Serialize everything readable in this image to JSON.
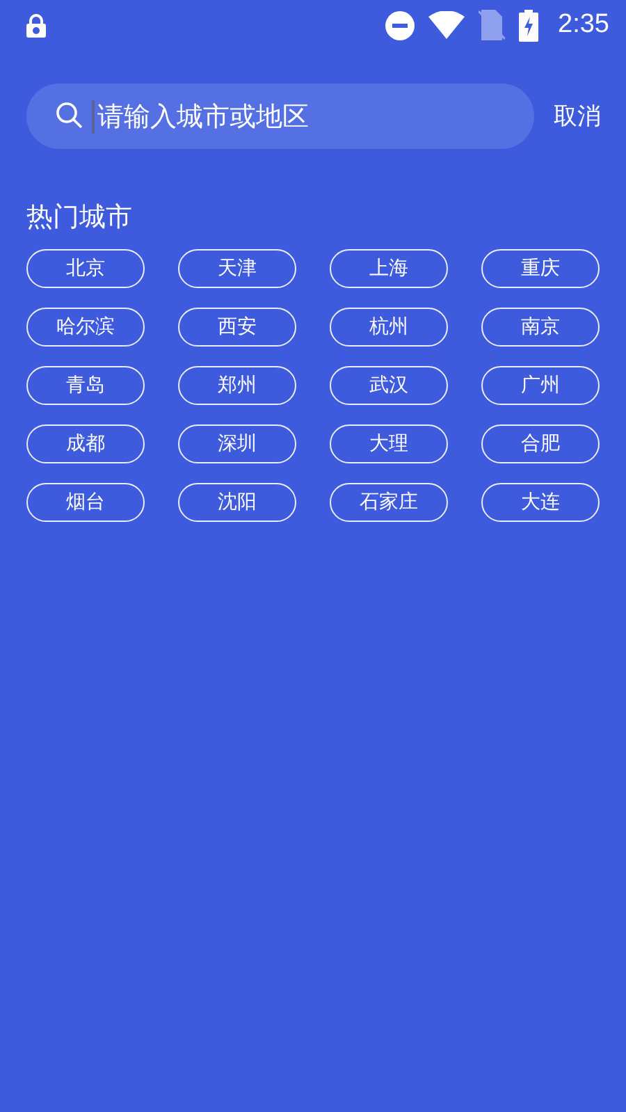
{
  "status_bar": {
    "time": "2:35"
  },
  "search": {
    "placeholder": "请输入城市或地区",
    "cancel": "取消"
  },
  "hot_cities": {
    "title": "热门城市",
    "items": [
      "北京",
      "天津",
      "上海",
      "重庆",
      "哈尔滨",
      "西安",
      "杭州",
      "南京",
      "青岛",
      "郑州",
      "武汉",
      "广州",
      "成都",
      "深圳",
      "大理",
      "合肥",
      "烟台",
      "沈阳",
      "石家庄",
      "大连"
    ]
  }
}
